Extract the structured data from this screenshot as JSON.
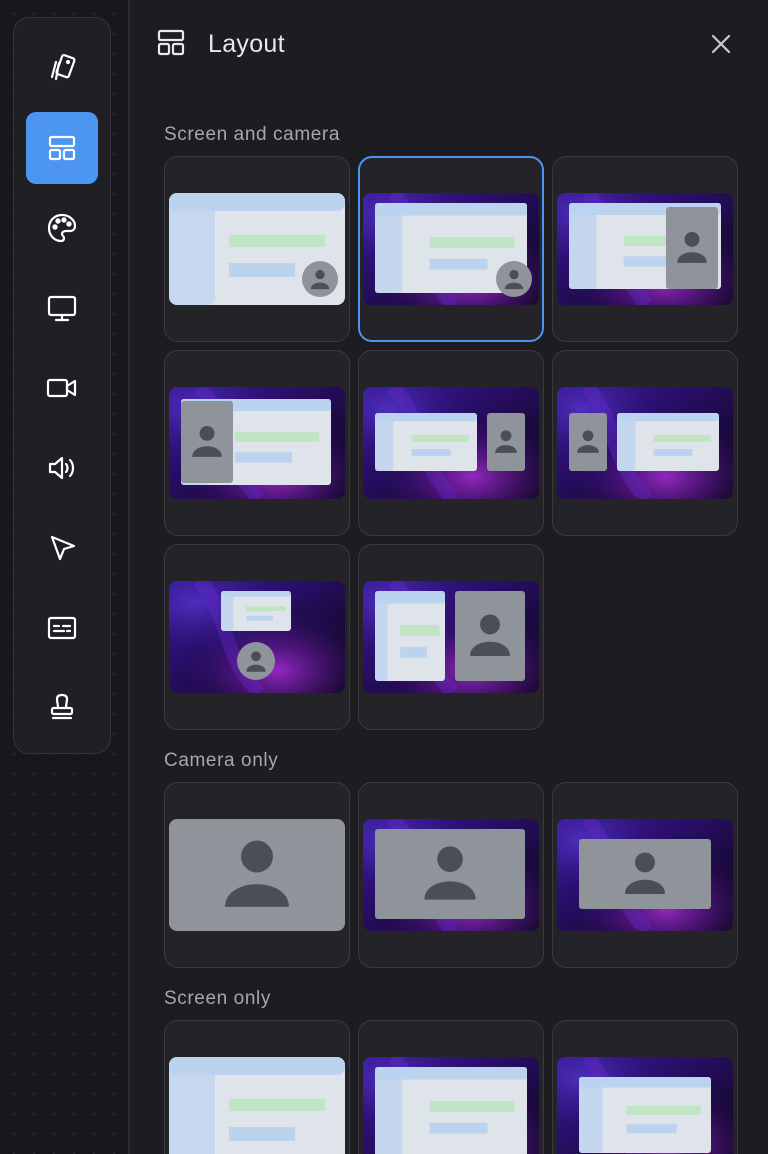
{
  "colors": {
    "accent": "#4c95f0",
    "panel_bg": "#1c1c21",
    "card_border": "#3a3a40",
    "preview_light": "#dfe3ea",
    "preview_green": "#c0e5c4",
    "preview_blue": "#bcd3ef",
    "avatar_bg": "#8f939a",
    "avatar_fg": "#4b4e54"
  },
  "sidebar": {
    "tools": [
      {
        "icon": "background-cards-icon",
        "active": false
      },
      {
        "icon": "layout-icon",
        "active": true
      },
      {
        "icon": "palette-icon",
        "active": false
      },
      {
        "icon": "monitor-icon",
        "active": false
      },
      {
        "icon": "video-camera-icon",
        "active": false
      },
      {
        "icon": "speaker-icon",
        "active": false
      },
      {
        "icon": "cursor-pointer-icon",
        "active": false
      },
      {
        "icon": "captions-icon",
        "active": false
      },
      {
        "icon": "stamp-icon",
        "active": false
      }
    ]
  },
  "panel": {
    "title": "Layout",
    "icon": "layout-icon",
    "close_icon": "close-icon"
  },
  "sections": {
    "screen_and_camera": {
      "label": "Screen and camera",
      "layouts": [
        {
          "name": "screen-camera-bubble-corner-plain",
          "selected": false
        },
        {
          "name": "screen-camera-bubble-corner-wallpaper",
          "selected": true
        },
        {
          "name": "screen-camera-panel-right-overlay",
          "selected": false
        },
        {
          "name": "screen-camera-panel-left-overlay",
          "selected": false
        },
        {
          "name": "screen-camera-side-by-side-right",
          "selected": false
        },
        {
          "name": "screen-camera-side-by-side-left",
          "selected": false
        },
        {
          "name": "screen-camera-stacked-center",
          "selected": false
        },
        {
          "name": "screen-camera-split-half",
          "selected": false
        }
      ]
    },
    "camera_only": {
      "label": "Camera only",
      "layouts": [
        {
          "name": "camera-only-plain",
          "selected": false
        },
        {
          "name": "camera-only-wallpaper-large",
          "selected": false
        },
        {
          "name": "camera-only-wallpaper-small",
          "selected": false
        }
      ]
    },
    "screen_only": {
      "label": "Screen only",
      "layouts": [
        {
          "name": "screen-only-plain",
          "selected": false
        },
        {
          "name": "screen-only-wallpaper-large",
          "selected": false
        },
        {
          "name": "screen-only-wallpaper-small",
          "selected": false
        }
      ]
    }
  }
}
